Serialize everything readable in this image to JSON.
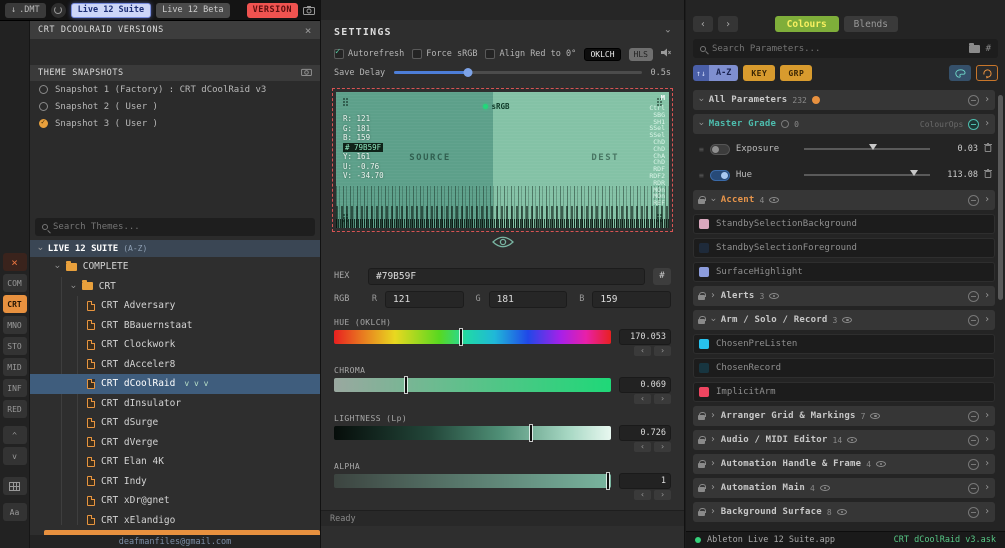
{
  "icons": {
    "chevron": "›",
    "close": "×",
    "download": "↓",
    "sort_arrows": "↑↓",
    "hash": "#",
    "grip": "≡"
  },
  "topbar": {
    "dmt": ".DMT",
    "suite": "Live 12 Suite",
    "beta": "Live 12 Beta",
    "version": "VERSION"
  },
  "strip": {
    "close": "×",
    "com": "COM",
    "crt": "CRT",
    "mno": "MNO",
    "sto": "STO",
    "mid": "MID",
    "inf": "INF",
    "red": "RED",
    "up": "^",
    "down": "v",
    "aa": "Aa"
  },
  "left_panel": {
    "versions_header": "CRT DCOOLRAID VERSIONS",
    "snapshots_header": "THEME SNAPSHOTS",
    "snapshots": [
      {
        "label": "Snapshot 1 (Factory) : CRT dCoolRaid v3"
      },
      {
        "label": "Snapshot 2 ( User )"
      },
      {
        "label": "Snapshot 3 ( User )"
      }
    ],
    "search_placeholder": "Search Themes...",
    "tree_header": "LIVE 12 SUITE",
    "tree_header_sort": "(A-Z)",
    "folder_complete": "COMPLETE",
    "folder_crt": "CRT",
    "themes": [
      "CRT Adversary",
      "CRT BBauernstaat",
      "CRT Clockwork",
      "CRT dAcceler8",
      "CRT dCoolRaid",
      "CRT dInsulator",
      "CRT dSurge",
      "CRT dVerge",
      "CRT Elan 4K",
      "CRT Indy",
      "CRT xDr@gnet",
      "CRT xElandigo"
    ],
    "selected_suffix": "v v v",
    "footer_email": "deafmanfiles@gmail.com"
  },
  "settings": {
    "title": "SETTINGS",
    "autorefresh": "Autorefresh",
    "force_srgb": "Force sRGB",
    "align_red": "Align Red to 0°",
    "oklch": "OKLCH",
    "hls": "HLS",
    "save_delay_label": "Save Delay",
    "save_delay_value": "0.5s",
    "save_delay_pos": "30%",
    "preview": {
      "srgb": "sRGB",
      "source": "SOURCE",
      "dest": "DEST",
      "info_r": "R: 121",
      "info_g": "G: 181",
      "info_b": "B: 159",
      "info_hex": "# 79B59F",
      "info_y": "Y: 161",
      "info_u": "U: -0.76",
      "info_v": "V: -34.70",
      "m": "M",
      "channels": [
        "Ctrl",
        "SBG",
        "SH1",
        "SSel",
        "SSel",
        "ChD",
        "ChD",
        "ChA",
        "ChD",
        "RDF",
        "RDF2",
        "RDR",
        "MOn",
        "MOn",
        "REF"
      ],
      "left_color": "#5da08a",
      "right_color": "#84c2a6"
    },
    "hex_label": "HEX",
    "hex_value": "#79B59F",
    "rgb_label": "RGB",
    "r_label": "R",
    "r_value": "121",
    "g_label": "G",
    "g_value": "181",
    "b_label": "B",
    "b_value": "159",
    "hue_label": "HUE (OKLCH)",
    "hue_value": "170.053",
    "hue_pos": "46%",
    "chroma_label": "CHROMA",
    "chroma_value": "0.069",
    "chroma_pos": "26%",
    "lightness_label": "LIGHTNESS (Lp)",
    "lightness_value": "0.726",
    "lightness_pos": "71%",
    "alpha_label": "ALPHA",
    "alpha_value": "1",
    "alpha_pos": "99%",
    "status": "Ready",
    "step_prev": "‹",
    "step_next": "›"
  },
  "right_panel": {
    "nav_prev": "‹",
    "nav_next": "›",
    "tab_colours": "Colours",
    "tab_blends": "Blends",
    "search_placeholder": "Search Parameters...",
    "sort_az": "A-Z",
    "sort_key": "KEY",
    "sort_grp": "GRP",
    "groups": {
      "all": {
        "name": "All Parameters",
        "count": "232"
      },
      "master": {
        "name": "Master Grade",
        "count": "0",
        "tag": "ColourOps",
        "rows": [
          {
            "name": "Exposure",
            "value": "0.03",
            "pos": "55%"
          },
          {
            "name": "Hue",
            "value": "113.08",
            "pos": "87%"
          }
        ]
      },
      "accent": {
        "name": "Accent",
        "count": "4",
        "items": [
          {
            "name": "StandbySelectionBackground",
            "color": "#daa8be"
          },
          {
            "name": "StandbySelectionForeground",
            "color": "#1e2a3a"
          },
          {
            "name": "SurfaceHighlight",
            "color": "#8c9cdc"
          }
        ]
      },
      "alerts": {
        "name": "Alerts",
        "count": "3"
      },
      "arm": {
        "name": "Arm / Solo / Record",
        "count": "3",
        "items": [
          {
            "name": "ChosenPreListen",
            "color": "#27c2ee"
          },
          {
            "name": "ChosenRecord",
            "color": "#173540"
          },
          {
            "name": "ImplicitArm",
            "color": "#ee4560"
          }
        ]
      },
      "collapsed": [
        {
          "name": "Arranger Grid & Markings",
          "count": "7"
        },
        {
          "name": "Audio / MIDI Editor",
          "count": "14"
        },
        {
          "name": "Automation Handle & Frame",
          "count": "4"
        },
        {
          "name": "Automation Main",
          "count": "4"
        },
        {
          "name": "Background Surface",
          "count": "8"
        }
      ]
    },
    "footer_app": "Ableton Live 12 Suite.app",
    "footer_file": "CRT dCoolRaid v3.ask"
  },
  "colors": {
    "accent_orange": "#e8913f",
    "picked_teal": "#79b59f",
    "master_grade_teal": "#4dbdae",
    "accent_group_orange": "#e8954a",
    "colours_tab_bg": "#7fae3a",
    "colours_tab_text": "#f8f060",
    "version_red": "#ef5350",
    "suite_active_bg": "#cdd6f8",
    "selected_row_blue": "#3f5d7d"
  }
}
